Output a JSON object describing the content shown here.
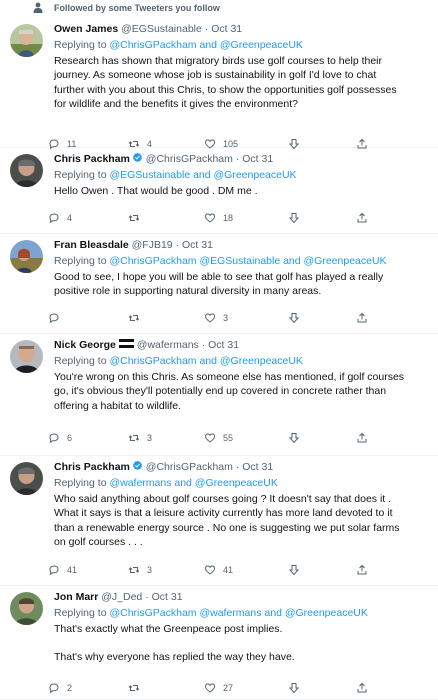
{
  "context": {
    "text": "Followed by some Tweeters you follow"
  },
  "tweets": [
    {
      "name": "Owen James",
      "handle": "@EGSustainable",
      "date": "Oct 31",
      "verified": false,
      "replying_prefix": "Replying to",
      "mentions": "@ChrisGPackham and @GreenpeaceUK",
      "lines": [
        "Research has shown that migratory birds use golf courses to help their",
        "journey. As someone whose job is sustainability in golf I'd love to chat",
        "further with you about this Chris, to show the opportunities golf possesses",
        "for wildlife and the benefits it gives the environment?"
      ],
      "replies": "11",
      "retweets": "4",
      "likes": "105"
    },
    {
      "name": "Chris Packham",
      "handle": "@ChrisGPackham",
      "date": "Oct 31",
      "verified": true,
      "replying_prefix": "Replying to",
      "mentions": "@EGSustainable and @GreenpeaceUK",
      "lines": [
        "Hello Owen . That would be good . DM me ."
      ],
      "replies": "4",
      "retweets": "",
      "likes": "18"
    },
    {
      "name": "Fran Bleasdale",
      "handle": "@FJB19",
      "date": "Oct 31",
      "verified": false,
      "replying_prefix": "Replying to",
      "mentions": "@ChrisGPackham @EGSustainable and @GreenpeaceUK",
      "lines": [
        "Good to see, I hope you will be able to see that golf has played a really",
        "positive role in supporting natural diversity in many areas."
      ],
      "replies": "",
      "retweets": "",
      "likes": "3"
    },
    {
      "name": "Nick George",
      "handle": "@wafermans",
      "date": "Oct 31",
      "verified": false,
      "flag": "estonia-flag",
      "replying_prefix": "Replying to",
      "mentions": "@ChrisGPackham and @GreenpeaceUK",
      "lines": [
        "You're wrong on this Chris. As someone else has mentioned, if golf courses",
        "go, it's obvious they'll potentially end up covered in concrete rather than",
        "offering a habitat to wildlife."
      ],
      "replies": "6",
      "retweets": "3",
      "likes": "55"
    },
    {
      "name": "Chris Packham",
      "handle": "@ChrisGPackham",
      "date": "Oct 31",
      "verified": true,
      "replying_prefix": "Replying to",
      "mentions": "@wafermans and @GreenpeaceUK",
      "lines": [
        "Who said anything about golf courses going ? It doesn't say that does it .",
        "What it says is that a leisure activity currently has more land devoted to it",
        "than a renewable energy source . No one is suggesting we put solar farms",
        "on golf courses . . ."
      ],
      "replies": "41",
      "retweets": "3",
      "likes": "41"
    },
    {
      "name": "Jon Marr",
      "handle": "@J_Ded",
      "date": "Oct 31",
      "verified": false,
      "replying_prefix": "Replying to",
      "mentions": "@ChrisGPackham @wafermans and @GreenpeaceUK",
      "lines": [
        "That's exactly what the Greenpeace post implies.",
        "",
        "That's why everyone has replied the way they have."
      ],
      "replies": "2",
      "retweets": "",
      "likes": "27"
    }
  ],
  "colors": {
    "accent": "#1d9bf0",
    "muted": "#536471",
    "text": "#0f1419",
    "divider": "#eff3f4"
  },
  "icons": [
    "person-icon",
    "reply-icon",
    "retweet-icon",
    "like-icon",
    "downvote-icon",
    "share-icon",
    "verified-badge-icon"
  ]
}
